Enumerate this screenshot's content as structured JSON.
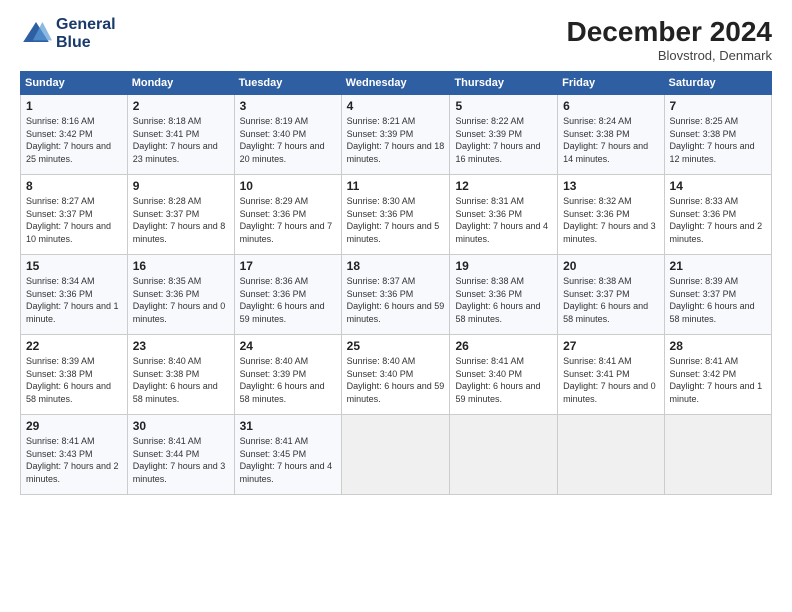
{
  "header": {
    "logo_line1": "General",
    "logo_line2": "Blue",
    "month": "December 2024",
    "location": "Blovstrod, Denmark"
  },
  "days_of_week": [
    "Sunday",
    "Monday",
    "Tuesday",
    "Wednesday",
    "Thursday",
    "Friday",
    "Saturday"
  ],
  "weeks": [
    [
      {
        "day": "1",
        "text": "Sunrise: 8:16 AM\nSunset: 3:42 PM\nDaylight: 7 hours and 25 minutes."
      },
      {
        "day": "2",
        "text": "Sunrise: 8:18 AM\nSunset: 3:41 PM\nDaylight: 7 hours and 23 minutes."
      },
      {
        "day": "3",
        "text": "Sunrise: 8:19 AM\nSunset: 3:40 PM\nDaylight: 7 hours and 20 minutes."
      },
      {
        "day": "4",
        "text": "Sunrise: 8:21 AM\nSunset: 3:39 PM\nDaylight: 7 hours and 18 minutes."
      },
      {
        "day": "5",
        "text": "Sunrise: 8:22 AM\nSunset: 3:39 PM\nDaylight: 7 hours and 16 minutes."
      },
      {
        "day": "6",
        "text": "Sunrise: 8:24 AM\nSunset: 3:38 PM\nDaylight: 7 hours and 14 minutes."
      },
      {
        "day": "7",
        "text": "Sunrise: 8:25 AM\nSunset: 3:38 PM\nDaylight: 7 hours and 12 minutes."
      }
    ],
    [
      {
        "day": "8",
        "text": "Sunrise: 8:27 AM\nSunset: 3:37 PM\nDaylight: 7 hours and 10 minutes."
      },
      {
        "day": "9",
        "text": "Sunrise: 8:28 AM\nSunset: 3:37 PM\nDaylight: 7 hours and 8 minutes."
      },
      {
        "day": "10",
        "text": "Sunrise: 8:29 AM\nSunset: 3:36 PM\nDaylight: 7 hours and 7 minutes."
      },
      {
        "day": "11",
        "text": "Sunrise: 8:30 AM\nSunset: 3:36 PM\nDaylight: 7 hours and 5 minutes."
      },
      {
        "day": "12",
        "text": "Sunrise: 8:31 AM\nSunset: 3:36 PM\nDaylight: 7 hours and 4 minutes."
      },
      {
        "day": "13",
        "text": "Sunrise: 8:32 AM\nSunset: 3:36 PM\nDaylight: 7 hours and 3 minutes."
      },
      {
        "day": "14",
        "text": "Sunrise: 8:33 AM\nSunset: 3:36 PM\nDaylight: 7 hours and 2 minutes."
      }
    ],
    [
      {
        "day": "15",
        "text": "Sunrise: 8:34 AM\nSunset: 3:36 PM\nDaylight: 7 hours and 1 minute."
      },
      {
        "day": "16",
        "text": "Sunrise: 8:35 AM\nSunset: 3:36 PM\nDaylight: 7 hours and 0 minutes."
      },
      {
        "day": "17",
        "text": "Sunrise: 8:36 AM\nSunset: 3:36 PM\nDaylight: 6 hours and 59 minutes."
      },
      {
        "day": "18",
        "text": "Sunrise: 8:37 AM\nSunset: 3:36 PM\nDaylight: 6 hours and 59 minutes."
      },
      {
        "day": "19",
        "text": "Sunrise: 8:38 AM\nSunset: 3:36 PM\nDaylight: 6 hours and 58 minutes."
      },
      {
        "day": "20",
        "text": "Sunrise: 8:38 AM\nSunset: 3:37 PM\nDaylight: 6 hours and 58 minutes."
      },
      {
        "day": "21",
        "text": "Sunrise: 8:39 AM\nSunset: 3:37 PM\nDaylight: 6 hours and 58 minutes."
      }
    ],
    [
      {
        "day": "22",
        "text": "Sunrise: 8:39 AM\nSunset: 3:38 PM\nDaylight: 6 hours and 58 minutes."
      },
      {
        "day": "23",
        "text": "Sunrise: 8:40 AM\nSunset: 3:38 PM\nDaylight: 6 hours and 58 minutes."
      },
      {
        "day": "24",
        "text": "Sunrise: 8:40 AM\nSunset: 3:39 PM\nDaylight: 6 hours and 58 minutes."
      },
      {
        "day": "25",
        "text": "Sunrise: 8:40 AM\nSunset: 3:40 PM\nDaylight: 6 hours and 59 minutes."
      },
      {
        "day": "26",
        "text": "Sunrise: 8:41 AM\nSunset: 3:40 PM\nDaylight: 6 hours and 59 minutes."
      },
      {
        "day": "27",
        "text": "Sunrise: 8:41 AM\nSunset: 3:41 PM\nDaylight: 7 hours and 0 minutes."
      },
      {
        "day": "28",
        "text": "Sunrise: 8:41 AM\nSunset: 3:42 PM\nDaylight: 7 hours and 1 minute."
      }
    ],
    [
      {
        "day": "29",
        "text": "Sunrise: 8:41 AM\nSunset: 3:43 PM\nDaylight: 7 hours and 2 minutes."
      },
      {
        "day": "30",
        "text": "Sunrise: 8:41 AM\nSunset: 3:44 PM\nDaylight: 7 hours and 3 minutes."
      },
      {
        "day": "31",
        "text": "Sunrise: 8:41 AM\nSunset: 3:45 PM\nDaylight: 7 hours and 4 minutes."
      },
      {
        "day": "",
        "text": ""
      },
      {
        "day": "",
        "text": ""
      },
      {
        "day": "",
        "text": ""
      },
      {
        "day": "",
        "text": ""
      }
    ]
  ]
}
